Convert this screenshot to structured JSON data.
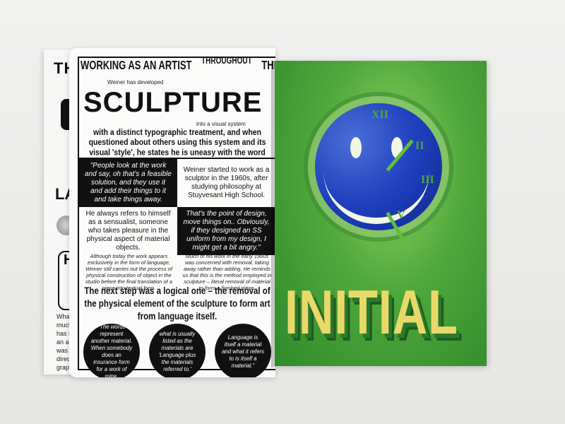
{
  "back_page": {
    "title_fragment": "TH",
    "la_fragment": "LA",
    "box_fragment": "H",
    "text_fragment": "What w much t has spe an artis it was directly of grap aware of the y to know",
    "bottom_fragment": "W H"
  },
  "left_page": {
    "header": [
      "WORKING AS AN ARTIST",
      "THROUGHOUT",
      "THE PAST FOUR DECADES"
    ],
    "sub_before_title": "Weiner has developed",
    "title": "SCULPTURE",
    "sub_after_title": "into a visual system",
    "intro": "with a distinct typographic treatment, and when questioned about others using this system and its visual 'style', he states he is uneasy with the word plagiarise:",
    "grid": [
      {
        "text": "\"People look at the work and say, oh that's a feasible solution, and they use it and add their things to it and take things away.",
        "style": "dark"
      },
      {
        "text": "Weiner started to work as a sculptor in the 1960s, after studying philosophy at Stuyvesant High School.",
        "style": "light"
      },
      {
        "text": "He always refers to himself as a sensualist, someone who takes pleasure in the physical aspect of material objects.",
        "style": "light"
      },
      {
        "text": "That's the point of design, move things on.. Obviously, if they designed an SS uniform from my design, I might get a bit angry.\"",
        "style": "dark"
      }
    ],
    "column_left": "Although today the work appears exclusively in the form of language, Weiner still carries out the process of physical construction of object in the studio before the final translation of a piece into textual form.",
    "column_right": "Much of his work in the early 1960s was concerned with removal, taking away rather than adding. He reminds us that this is the method employed in sculpture – literal removal of material to form a finished piece.",
    "next_step": "The next step was a logical one – the removal of the physical element of the sculpture to form art from language itself.",
    "bubbles": [
      "\"The words represent another material. When somebody does an insurance form for a work of mine,",
      "what is usually listed as the materials are 'Language plus the materials referred to.'",
      "Language is itself a material and what it refers to is itself a material.\""
    ]
  },
  "right_page": {
    "word": "INITIAL",
    "numerals": [
      "XII",
      "II",
      "III",
      "V"
    ]
  }
}
